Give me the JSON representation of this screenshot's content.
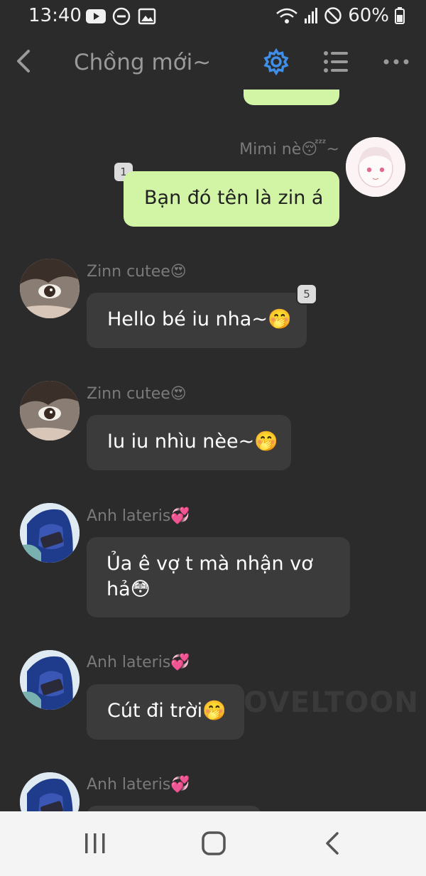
{
  "status_bar": {
    "time": "13:40",
    "battery": "60%",
    "icons": [
      "youtube-icon",
      "do-not-disturb-icon",
      "image-icon",
      "wifi-icon",
      "signal-icon",
      "blocked-icon",
      "battery-icon"
    ]
  },
  "header": {
    "title": "Chồng mới~",
    "accent": "#3f8fe8",
    "icons": [
      "back-arrow-icon",
      "gear-icon",
      "list-icon",
      "more-dots-icon"
    ]
  },
  "messages": [
    {
      "direction": "out",
      "sender": "Mimi nè😴~",
      "text": "Bạn đó tên là zin á",
      "badge": "1"
    },
    {
      "direction": "in",
      "sender": "Zinn cutee😍",
      "text": "Hello bé iu nha~🤭",
      "badge": "5"
    },
    {
      "direction": "in",
      "sender": "Zinn cutee😍",
      "text": "Iu iu nhìu nèe~🤭"
    },
    {
      "direction": "in",
      "sender": "Anh lateris💞",
      "text_line1": "Ủa ê vợ t mà nhận vơ",
      "text_line2": "hả😳"
    },
    {
      "direction": "in",
      "sender": "Anh lateris💞",
      "text": "Cút đi trời🤭"
    },
    {
      "direction": "in",
      "sender": "Anh lateris💞",
      "text": ""
    }
  ],
  "watermark": "OVELTOON",
  "colors": {
    "out_bubble": "#d1f4a5",
    "in_bubble": "#3b3b3b",
    "background": "#2b2b2b"
  }
}
